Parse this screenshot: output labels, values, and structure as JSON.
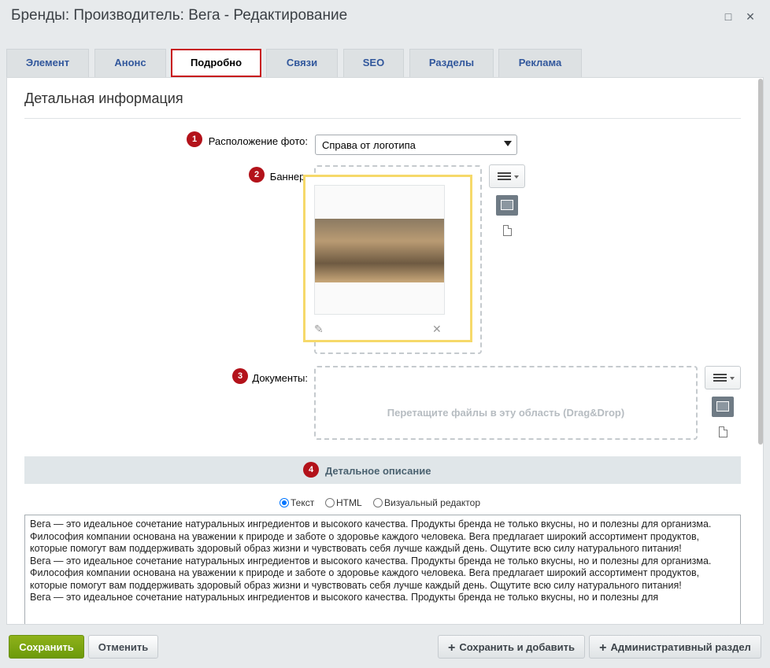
{
  "window": {
    "title": "Бренды: Производитель: Вега - Редактирование",
    "maximize_icon": "□",
    "close_icon": "✕"
  },
  "tabs": [
    {
      "label": "Элемент"
    },
    {
      "label": "Анонс"
    },
    {
      "label": "Подробно",
      "active": true
    },
    {
      "label": "Связи"
    },
    {
      "label": "SEO"
    },
    {
      "label": "Разделы"
    },
    {
      "label": "Реклама"
    }
  ],
  "section": {
    "title": "Детальная информация"
  },
  "fields": {
    "photo_position": {
      "badge": "1",
      "label": "Расположение фото:",
      "value": "Справа от логотипа"
    },
    "banner": {
      "badge": "2",
      "label": "Баннер:"
    },
    "documents": {
      "badge": "3",
      "label": "Документы:",
      "drop_text": "Перетащите файлы в эту область (Drag&Drop)"
    }
  },
  "description": {
    "badge": "4",
    "title": "Детальное описание",
    "modes": [
      "Текст",
      "HTML",
      "Визуальный редактор"
    ],
    "selected_mode": "Текст",
    "text": "Вега — это идеальное сочетание натуральных ингредиентов и высокого качества. Продукты бренда не только вкусны, но и полезны для организма. Философия компании основана на уважении к природе и заботе о здоровье каждого человека. Вега предлагает широкий ассортимент продуктов, которые помогут вам поддерживать здоровый образ жизни и чувствовать себя лучше каждый день. Ощутите всю силу натурального питания!\nВега — это идеальное сочетание натуральных ингредиентов и высокого качества. Продукты бренда не только вкусны, но и полезны для организма. Философия компании основана на уважении к природе и заботе о здоровье каждого человека. Вега предлагает широкий ассортимент продуктов, которые помогут вам поддерживать здоровый образ жизни и чувствовать себя лучше каждый день. Ощутите всю силу натурального питания!\nВега — это идеальное сочетание натуральных ингредиентов и высокого качества. Продукты бренда не только вкусны, но и полезны для"
  },
  "footer": {
    "save": "Сохранить",
    "cancel": "Отменить",
    "save_and_add": "Сохранить и добавить",
    "admin_section": "Административный раздел"
  },
  "colors": {
    "accent_red": "#b3121a",
    "save_green": "#7aa612",
    "active_tab_border": "#c8151b"
  }
}
